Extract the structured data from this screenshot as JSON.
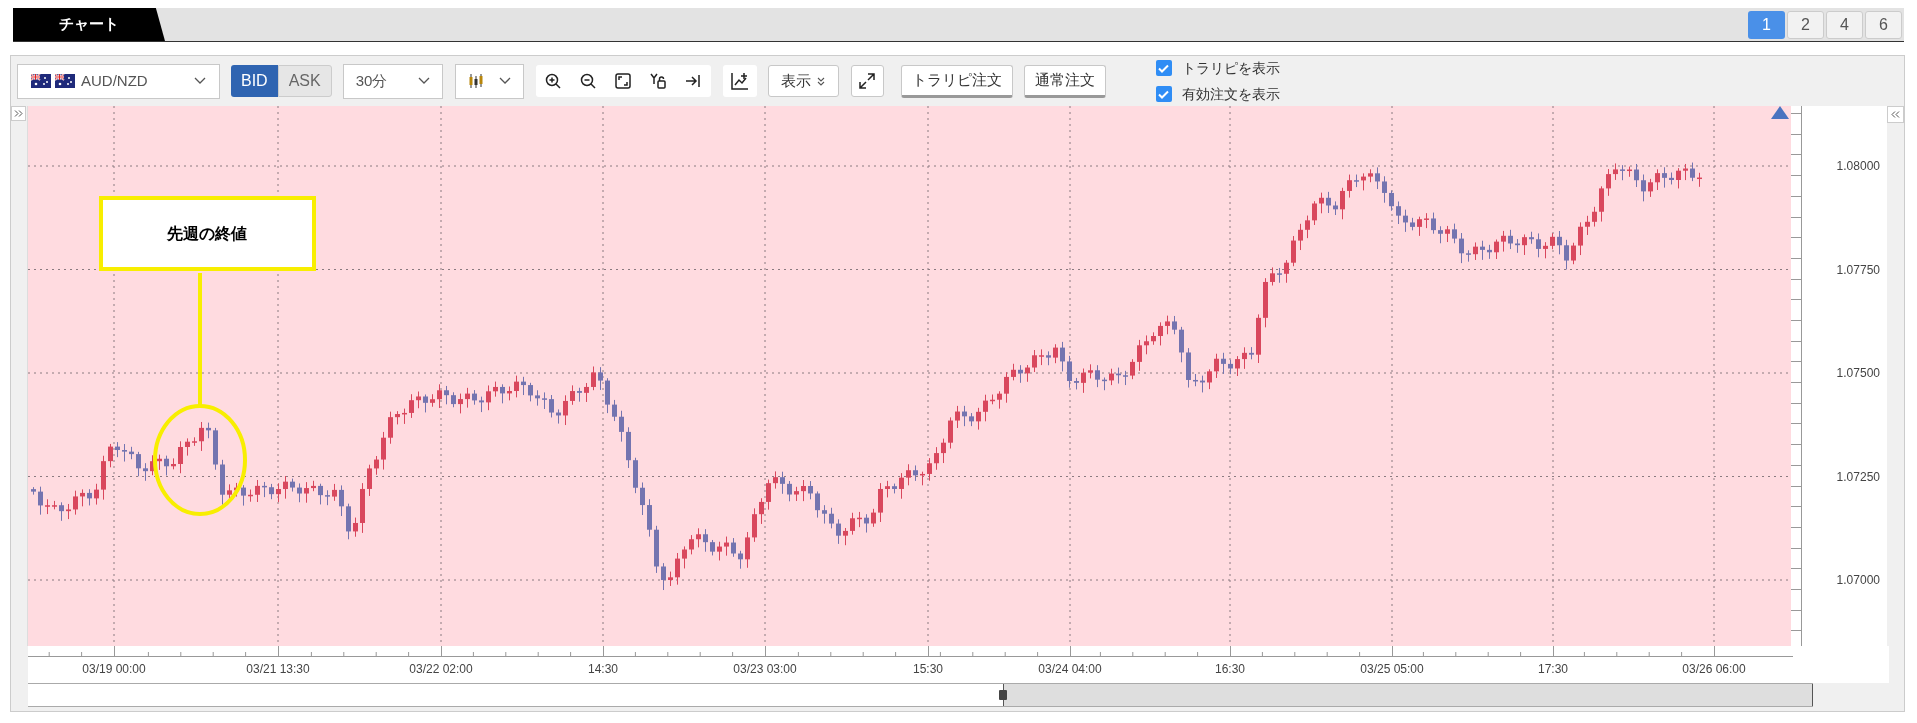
{
  "tab": {
    "label": "チャート"
  },
  "layout_buttons": [
    {
      "label": "1",
      "selected": true
    },
    {
      "label": "2",
      "selected": false
    },
    {
      "label": "4",
      "selected": false
    },
    {
      "label": "6",
      "selected": false
    }
  ],
  "toolbar": {
    "symbol": "AUD/NZD",
    "price_side": [
      {
        "label": "BID",
        "selected": true
      },
      {
        "label": "ASK",
        "selected": false
      }
    ],
    "timeframe": "30分",
    "display_button": "表示",
    "order_buttons": [
      "トラリピ注文",
      "通常注文"
    ],
    "checkboxes": [
      {
        "label": "トラリピを表示",
        "checked": true
      },
      {
        "label": "有効注文を表示",
        "checked": true
      }
    ]
  },
  "chart": {
    "annotation": "先週の終値",
    "y_axis_labels": [
      "1.08000",
      "1.07750",
      "1.07500",
      "1.07250",
      "1.07000"
    ],
    "x_axis_labels": [
      "03/19 00:00",
      "03/21 13:30",
      "03/22 02:00",
      "14:30",
      "03/23 03:00",
      "15:30",
      "03/24 04:00",
      "16:30",
      "03/25 05:00",
      "17:30",
      "03/26 06:00"
    ]
  }
}
